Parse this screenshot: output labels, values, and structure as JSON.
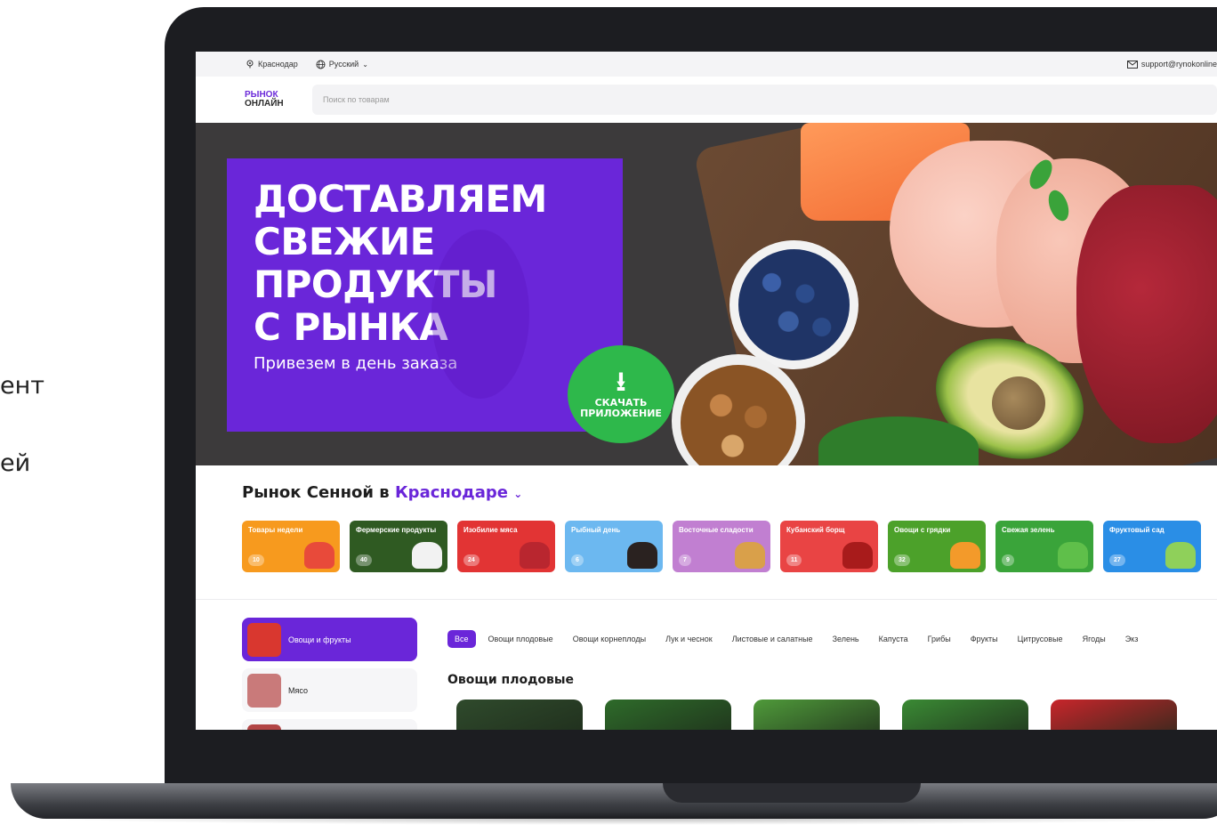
{
  "side_text": [
    "ент",
    "ей"
  ],
  "topbar": {
    "city": "Краснодар",
    "language": "Русский",
    "email": "support@rynokonline"
  },
  "header": {
    "logo_line1": "РЫНОК",
    "logo_line2": "ОНЛАЙН",
    "search_placeholder": "Поиск по товарам"
  },
  "hero": {
    "headline": [
      "ДОСТАВЛЯЕМ",
      "СВЕЖИЕ",
      "ПРОДУКТЫ",
      "С РЫНКА"
    ],
    "subtitle": "Привезем в день заказа",
    "download_label_1": "СКАЧАТЬ",
    "download_label_2": "ПРИЛОЖЕНИЕ"
  },
  "market": {
    "title_prefix": "Рынок Сенной в",
    "city": "Краснодаре",
    "categories": [
      {
        "label": "Товары недели",
        "count": "10",
        "color": "#f79a1e",
        "pic": "#e84a3a"
      },
      {
        "label": "Фермерские продукты",
        "count": "40",
        "color": "#2f5a22",
        "pic": "#f2f2f2"
      },
      {
        "label": "Изобилие мяса",
        "count": "24",
        "color": "#e23434",
        "pic": "#b9262f"
      },
      {
        "label": "Рыбный день",
        "count": "6",
        "color": "#6cb8f0",
        "pic": "#2a2220"
      },
      {
        "label": "Восточные сладости",
        "count": "7",
        "color": "#c17fd1",
        "pic": "#d9a04a"
      },
      {
        "label": "Кубанский борщ",
        "count": "11",
        "color": "#e94444",
        "pic": "#a81b1b"
      },
      {
        "label": "Овощи с грядки",
        "count": "32",
        "color": "#4ca12a",
        "pic": "#f39a2a"
      },
      {
        "label": "Свежая зелень",
        "count": "9",
        "color": "#3aa43a",
        "pic": "#5fbf4a"
      },
      {
        "label": "Фруктовый сад",
        "count": "27",
        "color": "#2a8ee6",
        "pic": "#8fd05a"
      }
    ]
  },
  "catalog": {
    "left_items": [
      {
        "label": "Овощи и фрукты",
        "active": true,
        "thumb": "#d9372f"
      },
      {
        "label": "Мясо",
        "active": false,
        "thumb": "#c97a7a"
      },
      {
        "label": "",
        "active": false,
        "thumb": "#b24545"
      }
    ],
    "filters": [
      "Все",
      "Овощи плодовые",
      "Овощи корнеплоды",
      "Лук и чеснок",
      "Листовые и салатные",
      "Зелень",
      "Капуста",
      "Грибы",
      "Фрукты",
      "Цитрусовые",
      "Ягоды",
      "Экз"
    ],
    "section_title": "Овощи плодовые",
    "product_colors": [
      "#2f4a2c",
      "#2e6b2a",
      "#4f9a3a",
      "#3a8a34",
      "#c8252b"
    ]
  },
  "colors": {
    "accent": "#6a26d9",
    "download_green": "#2eb84b"
  }
}
